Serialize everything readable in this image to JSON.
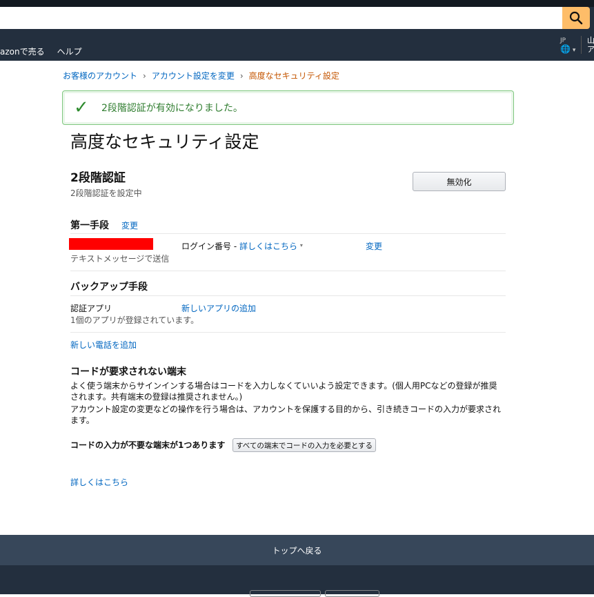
{
  "header": {
    "nav_items": [
      "azonで売る",
      "ヘルプ"
    ],
    "lang_code": "JP",
    "right_cut": "山 ア"
  },
  "breadcrumb": {
    "items": [
      "お客様のアカウント",
      "アカウント設定を変更"
    ],
    "current": "高度なセキュリティ設定"
  },
  "alert": {
    "message": "2段階認証が有効になりました。"
  },
  "page_title": "高度なセキュリティ設定",
  "two_step": {
    "heading": "2段階認証",
    "status": "2段階認証を設定中",
    "disable_label": "無効化"
  },
  "primary": {
    "heading": "第一手段",
    "change_label": "変更",
    "method_note": "テキストメッセージで送信",
    "login_prefix": "ログイン番号 - ",
    "learn_more": "詳しくはこちら",
    "change2_label": "変更"
  },
  "backup": {
    "heading": "バックアップ手段",
    "auth_app": "認証アプリ",
    "add_app": "新しいアプリの追加",
    "app_count": "1個のアプリが登録されています。",
    "add_phone": "新しい電話を追加"
  },
  "no_code": {
    "heading": "コードが要求されない端末",
    "para1": "よく使う端末からサインインする場合はコードを入力しなくていいよう設定できます。(個人用PCなどの登録が推奨されます。共有端末の登録は推奨されません。)",
    "para2": "アカウント設定の変更などの操作を行う場合は、アカウントを保護する目的から、引き続きコードの入力が要求されます。",
    "count_text": "コードの入力が不要な端末が1つあります",
    "require_all_label": "すべての端末でコードの入力を必要とする",
    "learn_more": "詳しくはこちら"
  },
  "footer": {
    "back_to_top": "トップへ戻る"
  }
}
